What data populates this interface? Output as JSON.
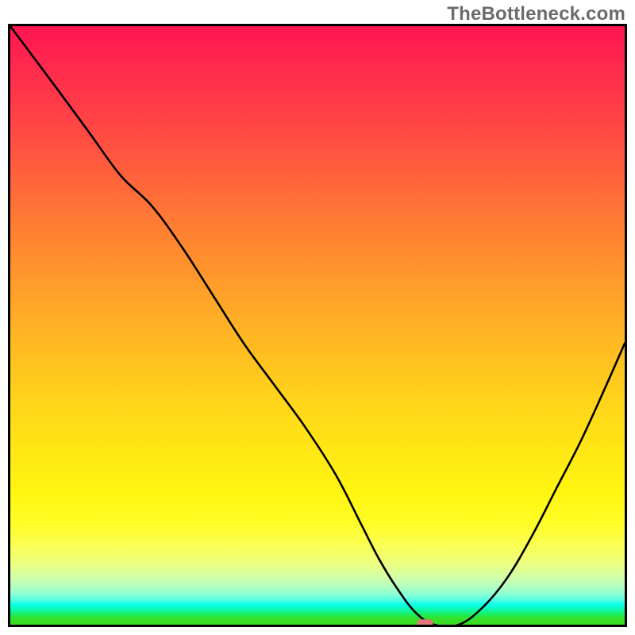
{
  "watermark": "TheBottleneck.com",
  "colors": {
    "curve": "#000000",
    "marker_fill": "#e07a7a",
    "marker_stroke": "#d26a6a",
    "gradient_top": "#ff1552",
    "gradient_bottom": "#3adc22"
  },
  "chart_data": {
    "type": "line",
    "title": "",
    "xlabel": "",
    "ylabel": "",
    "xlim": [
      0,
      100
    ],
    "ylim": [
      0,
      100
    ],
    "grid": false,
    "legend": false,
    "series": [
      {
        "name": "bottleneck-curve",
        "x": [
          0,
          8,
          13,
          18,
          23,
          28,
          33,
          38,
          43,
          48,
          53,
          57,
          60,
          63,
          66,
          69,
          73,
          77,
          81,
          85,
          89,
          93,
          97,
          100
        ],
        "y": [
          100,
          89,
          82,
          75,
          70,
          63,
          55,
          47,
          40,
          33,
          25,
          17,
          11,
          6,
          2,
          0,
          0,
          3,
          8,
          15,
          23,
          31,
          40,
          47
        ]
      }
    ],
    "marker": {
      "x": 67.5,
      "y": 0,
      "shape": "rounded-rect"
    },
    "background": "red-yellow-green vertical gradient (bottleneck heat scale)"
  }
}
